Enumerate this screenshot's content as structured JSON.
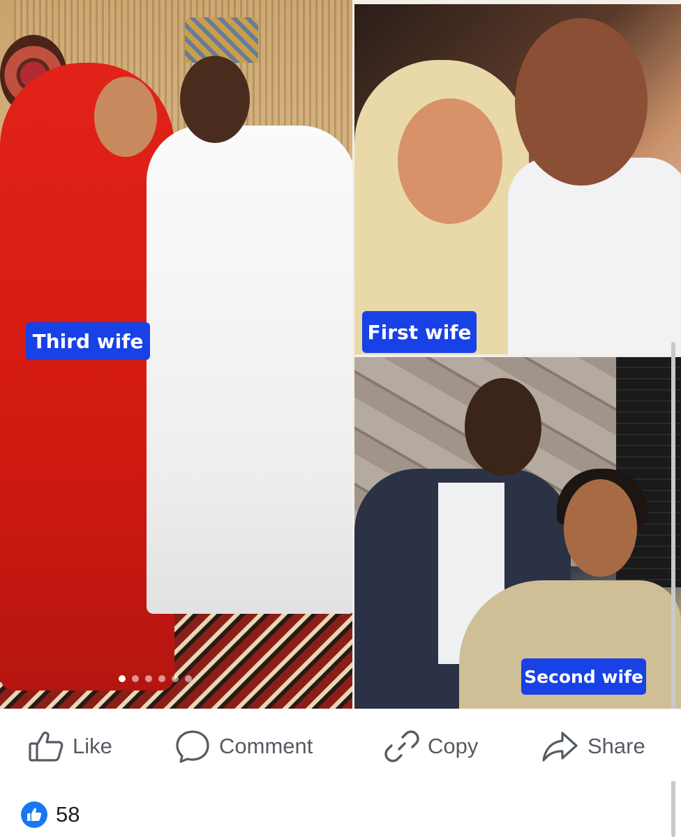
{
  "post": {
    "photos": [
      {
        "caption": "Third wife"
      },
      {
        "caption": "First wife"
      },
      {
        "caption": "Second wife"
      }
    ],
    "carousel": {
      "count": 6,
      "active_index": 0
    }
  },
  "actions": {
    "like_label": "Like",
    "comment_label": "Comment",
    "copy_label": "Copy",
    "share_label": "Share"
  },
  "reactions": {
    "icon": "thumbs-up-icon",
    "count": "58"
  },
  "colors": {
    "caption_bg": "#1841e6",
    "action_text": "#555b63",
    "like_badge": "#1877f2"
  }
}
